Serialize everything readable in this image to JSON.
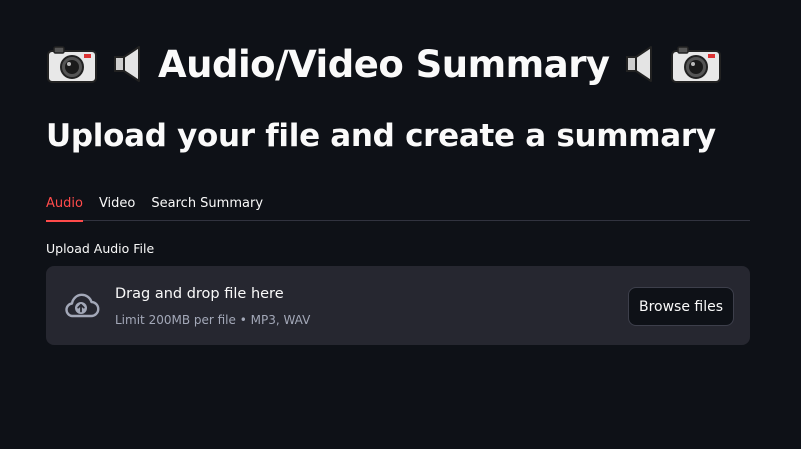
{
  "header": {
    "title": "Audio/Video Summary",
    "subtitle": "Upload your file and create a summary"
  },
  "tabs": [
    {
      "label": "Audio",
      "active": true
    },
    {
      "label": "Video",
      "active": false
    },
    {
      "label": "Search Summary",
      "active": false
    }
  ],
  "uploader": {
    "label": "Upload Audio File",
    "dropzone_text": "Drag and drop file here",
    "limit_text": "Limit 200MB per file • MP3, WAV",
    "browse_label": "Browse files",
    "icon": "cloud-upload-icon"
  },
  "colors": {
    "background": "#0e1117",
    "accent": "#ff4b4b",
    "dropzone": "#262730"
  }
}
